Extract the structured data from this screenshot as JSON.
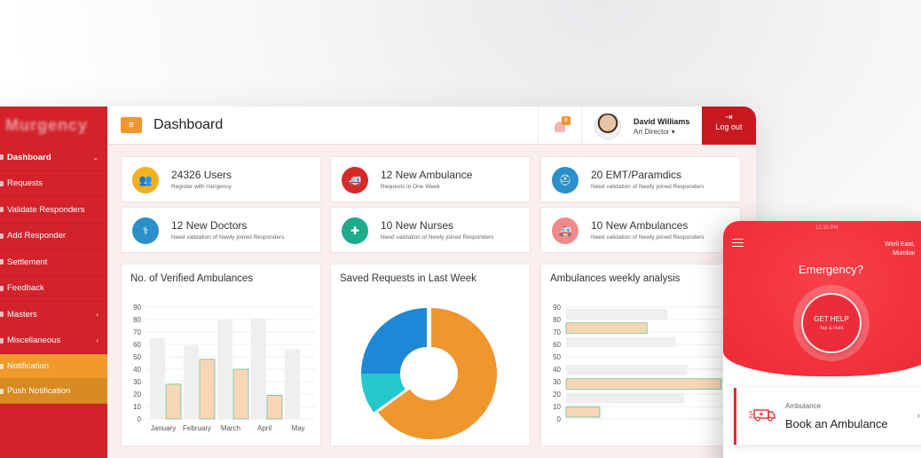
{
  "brand": {
    "name": "Murgency"
  },
  "sidebar": {
    "items": [
      {
        "label": "Dashboard",
        "caret": "⌄"
      },
      {
        "label": "Requests",
        "caret": ""
      },
      {
        "label": "Validate Responders",
        "caret": ""
      },
      {
        "label": "Add Responder",
        "caret": ""
      },
      {
        "label": "Settlement",
        "caret": ""
      },
      {
        "label": "Feedback",
        "caret": ""
      },
      {
        "label": "Masters",
        "caret": "‹"
      },
      {
        "label": "Miscellaneous",
        "caret": "‹"
      },
      {
        "label": "Notification",
        "caret": ""
      },
      {
        "label": "Push Notification",
        "caret": ""
      }
    ]
  },
  "header": {
    "menu_icon": "≡",
    "title": "Dashboard",
    "notification_count": "8",
    "user": {
      "name": "David Williams",
      "role": "Art Director ▾"
    },
    "logout_icon": "⇥",
    "logout_label": "Log out"
  },
  "stats": [
    {
      "value": "24326 Users",
      "sub": "Register with murgency",
      "color": "#f5b020",
      "icon": "👥"
    },
    {
      "value": "12 New Ambulance",
      "sub": "Requests in One Week",
      "color": "#d62a2a",
      "icon": "🚑"
    },
    {
      "value": "20 EMT/Paramdics",
      "sub": "Need validation of Newly joined Responders",
      "color": "#2b8fc9",
      "icon": "⛑"
    },
    {
      "value": "12 New Doctors",
      "sub": "Need validation of Newly joined Responders",
      "color": "#2b8fc9",
      "icon": "⚕"
    },
    {
      "value": "10 New Nurses",
      "sub": "Need validation of Newly joined Responders",
      "color": "#1faa8d",
      "icon": "✚"
    },
    {
      "value": "10 New Ambulances",
      "sub": "Need validation of Newly joined Responders",
      "color": "#f08a8a",
      "icon": "🚑"
    }
  ],
  "panels": {
    "verified": "No. of Verified Ambulances",
    "saved": "Saved Requests in Last Week",
    "weekly": "Ambulances weekly analysis"
  },
  "chart_data": [
    {
      "type": "bar",
      "title": "No. of Verified Ambulances",
      "categories": [
        "January",
        "February",
        "March",
        "April",
        "May"
      ],
      "series": [
        {
          "values": [
            65,
            59,
            80,
            81,
            56
          ],
          "color": "#efefef"
        },
        {
          "values": [
            28,
            48,
            40,
            19,
            0
          ],
          "color": "#f7d7b5"
        }
      ],
      "yticks": [
        0,
        10,
        20,
        30,
        40,
        50,
        60,
        70,
        80,
        90
      ],
      "ylim": [
        0,
        90
      ],
      "grid": true
    },
    {
      "type": "pie",
      "title": "Saved Requests in Last Week",
      "values": [
        65,
        10,
        25
      ],
      "colors": [
        "#ef962d",
        "#22c8cc",
        "#1e88d6"
      ],
      "donut": true
    },
    {
      "type": "bar",
      "orientation": "horizontal",
      "title": "Ambulances weekly analysis",
      "xticks": [
        0,
        10,
        20,
        30,
        40,
        50,
        60,
        70,
        80,
        90
      ],
      "series": [
        {
          "values": [
            60,
            0,
            65,
            0,
            72,
            0,
            70,
            0
          ],
          "color": "#efefef"
        },
        {
          "values": [
            0,
            48,
            0,
            0,
            0,
            92,
            0,
            20
          ],
          "color": "#f7d7b5"
        }
      ]
    }
  ],
  "phone": {
    "status": "12:30 PM",
    "location": "Worli East, Mumbai",
    "heading": "Emergency?",
    "button_label": "GET HELP",
    "button_sub": "Tap & Hold",
    "card_small": "Ambulance",
    "card_big": "Book an Ambulance",
    "card_arrow": "›"
  }
}
